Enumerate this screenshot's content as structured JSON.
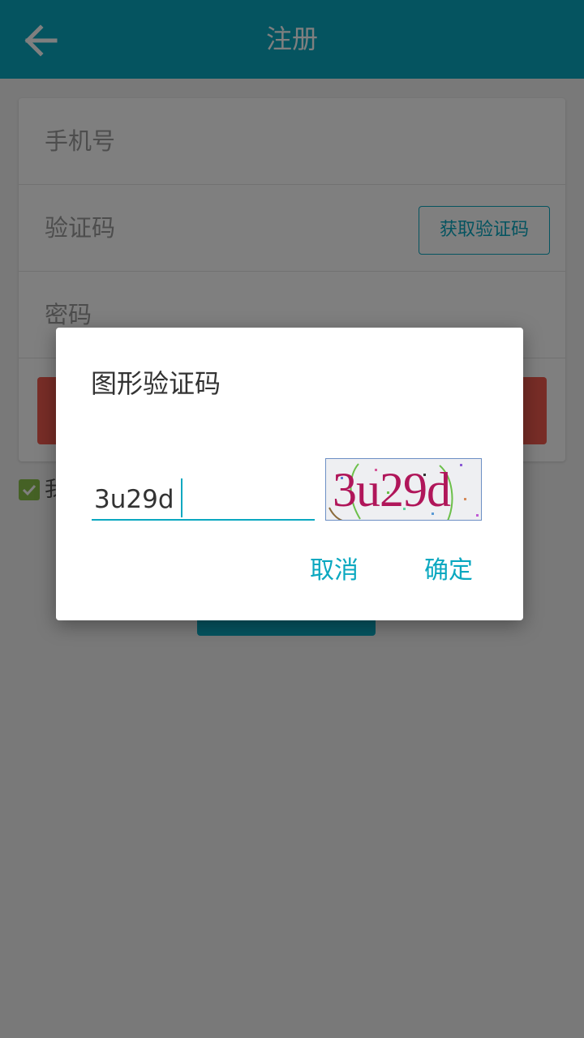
{
  "header": {
    "title": "注册",
    "back_icon": "arrow-left-icon"
  },
  "form": {
    "phone_placeholder": "手机号",
    "code_placeholder": "验证码",
    "get_code_label": "获取验证码",
    "password_placeholder": "密码"
  },
  "agreement": {
    "checked": true,
    "text_visible": "我"
  },
  "dialog": {
    "title": "图形验证码",
    "input_value": "3u29d",
    "captcha_text": "3u29d",
    "cancel_label": "取消",
    "confirm_label": "确定"
  },
  "colors": {
    "accent": "#0aa8c0",
    "danger": "#f05a4e",
    "check": "#8bc34a",
    "captcha_text": "#b0165a"
  }
}
